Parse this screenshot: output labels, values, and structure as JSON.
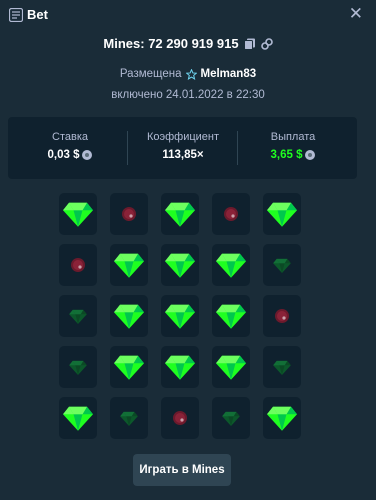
{
  "header": {
    "title": "Bet",
    "close_glyph": "✕",
    "icon": "bet-list-icon"
  },
  "mines_line": {
    "text": "Mines: 72 290 919 915",
    "icons": [
      "copy-icon",
      "link-icon"
    ]
  },
  "posted": {
    "label": "Размещена",
    "user": "Melman83",
    "user_icon": "star-badge-icon"
  },
  "date_line": "включено 24.01.2022 в 22:30",
  "stats": {
    "bet_label": "Ставка",
    "bet_value": "0,03 $",
    "multiplier_label": "Коэффициент",
    "multiplier_value": "113,85×",
    "payout_label": "Выплата",
    "payout_value": "3,65 $"
  },
  "colors": {
    "accent_green": "#1fff20",
    "background": "#1a2c38",
    "panel": "#0f212e",
    "mine_red": "#e23b5b"
  },
  "grid": [
    [
      "gem",
      "mine-dim",
      "gem",
      "mine-dim",
      "gem"
    ],
    [
      "mine-dim",
      "gem",
      "gem",
      "gem",
      "gem-dim"
    ],
    [
      "gem-dim",
      "gem",
      "gem",
      "gem",
      "mine-dim"
    ],
    [
      "gem-dim",
      "gem",
      "gem",
      "gem",
      "gem-dim"
    ],
    [
      "gem",
      "gem-dim",
      "mine-dim",
      "gem-dim",
      "gem"
    ]
  ],
  "play_button": "Играть в Mines"
}
